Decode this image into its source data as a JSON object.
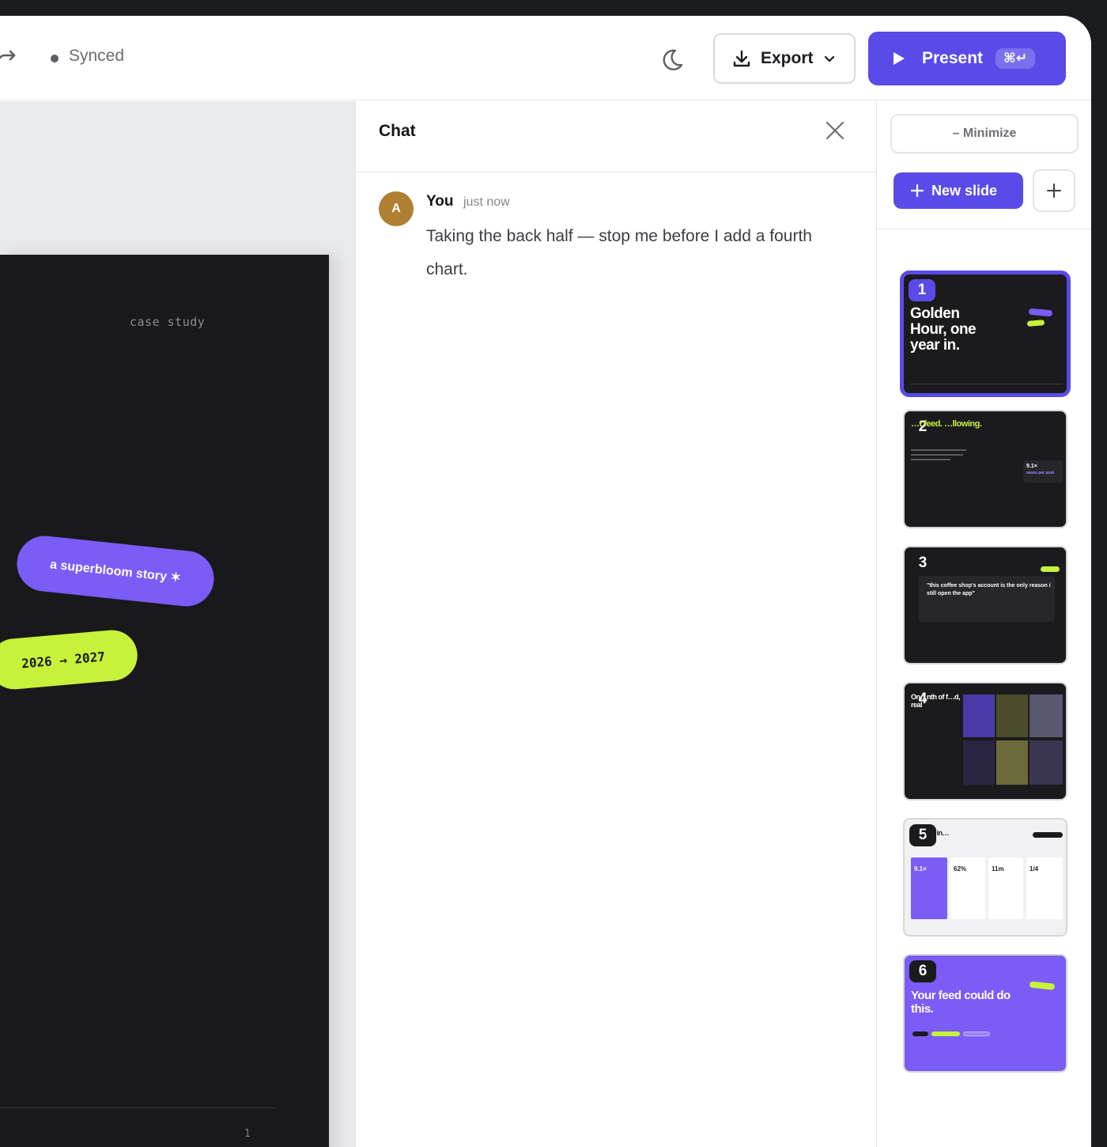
{
  "topbar": {
    "sync_status": "Synced",
    "export_label": "Export",
    "present_label": "Present",
    "present_shortcut": "⌘↵"
  },
  "slide": {
    "eyebrow": "case study",
    "tag_purple": "a superbloom story ✶",
    "tag_lime": "2026 → 2027",
    "page_number": "1"
  },
  "chat": {
    "title": "Chat",
    "messages": [
      {
        "avatar": "A",
        "author": "You",
        "time": "just now",
        "text": "Taking the back half — stop me before I add a fourth chart."
      }
    ]
  },
  "rail": {
    "minimize_label": "– Minimize",
    "new_slide_label": "New slide",
    "slides": [
      {
        "num": "1",
        "title": "Golden Hour, one year in."
      },
      {
        "num": "2",
        "title": "…t feed. …llowing.",
        "stat": "9.1×",
        "stat_label": "saves per post"
      },
      {
        "num": "3",
        "quote": "\"this coffee shop's account is the only reason i still open the app\"",
        "quote_highlight": "app"
      },
      {
        "num": "4",
        "title": "On…nth of f…d, real"
      },
      {
        "num": "5",
        "title": "Th…ear in…mbers",
        "stats": [
          "9.1×",
          "62%",
          "11m",
          "1/4"
        ]
      },
      {
        "num": "6",
        "title": "Your feed could do this."
      }
    ]
  },
  "colors": {
    "accent": "#5a4be8",
    "purple": "#7b5cf6",
    "lime": "#c7f23a",
    "dark": "#19191c"
  }
}
